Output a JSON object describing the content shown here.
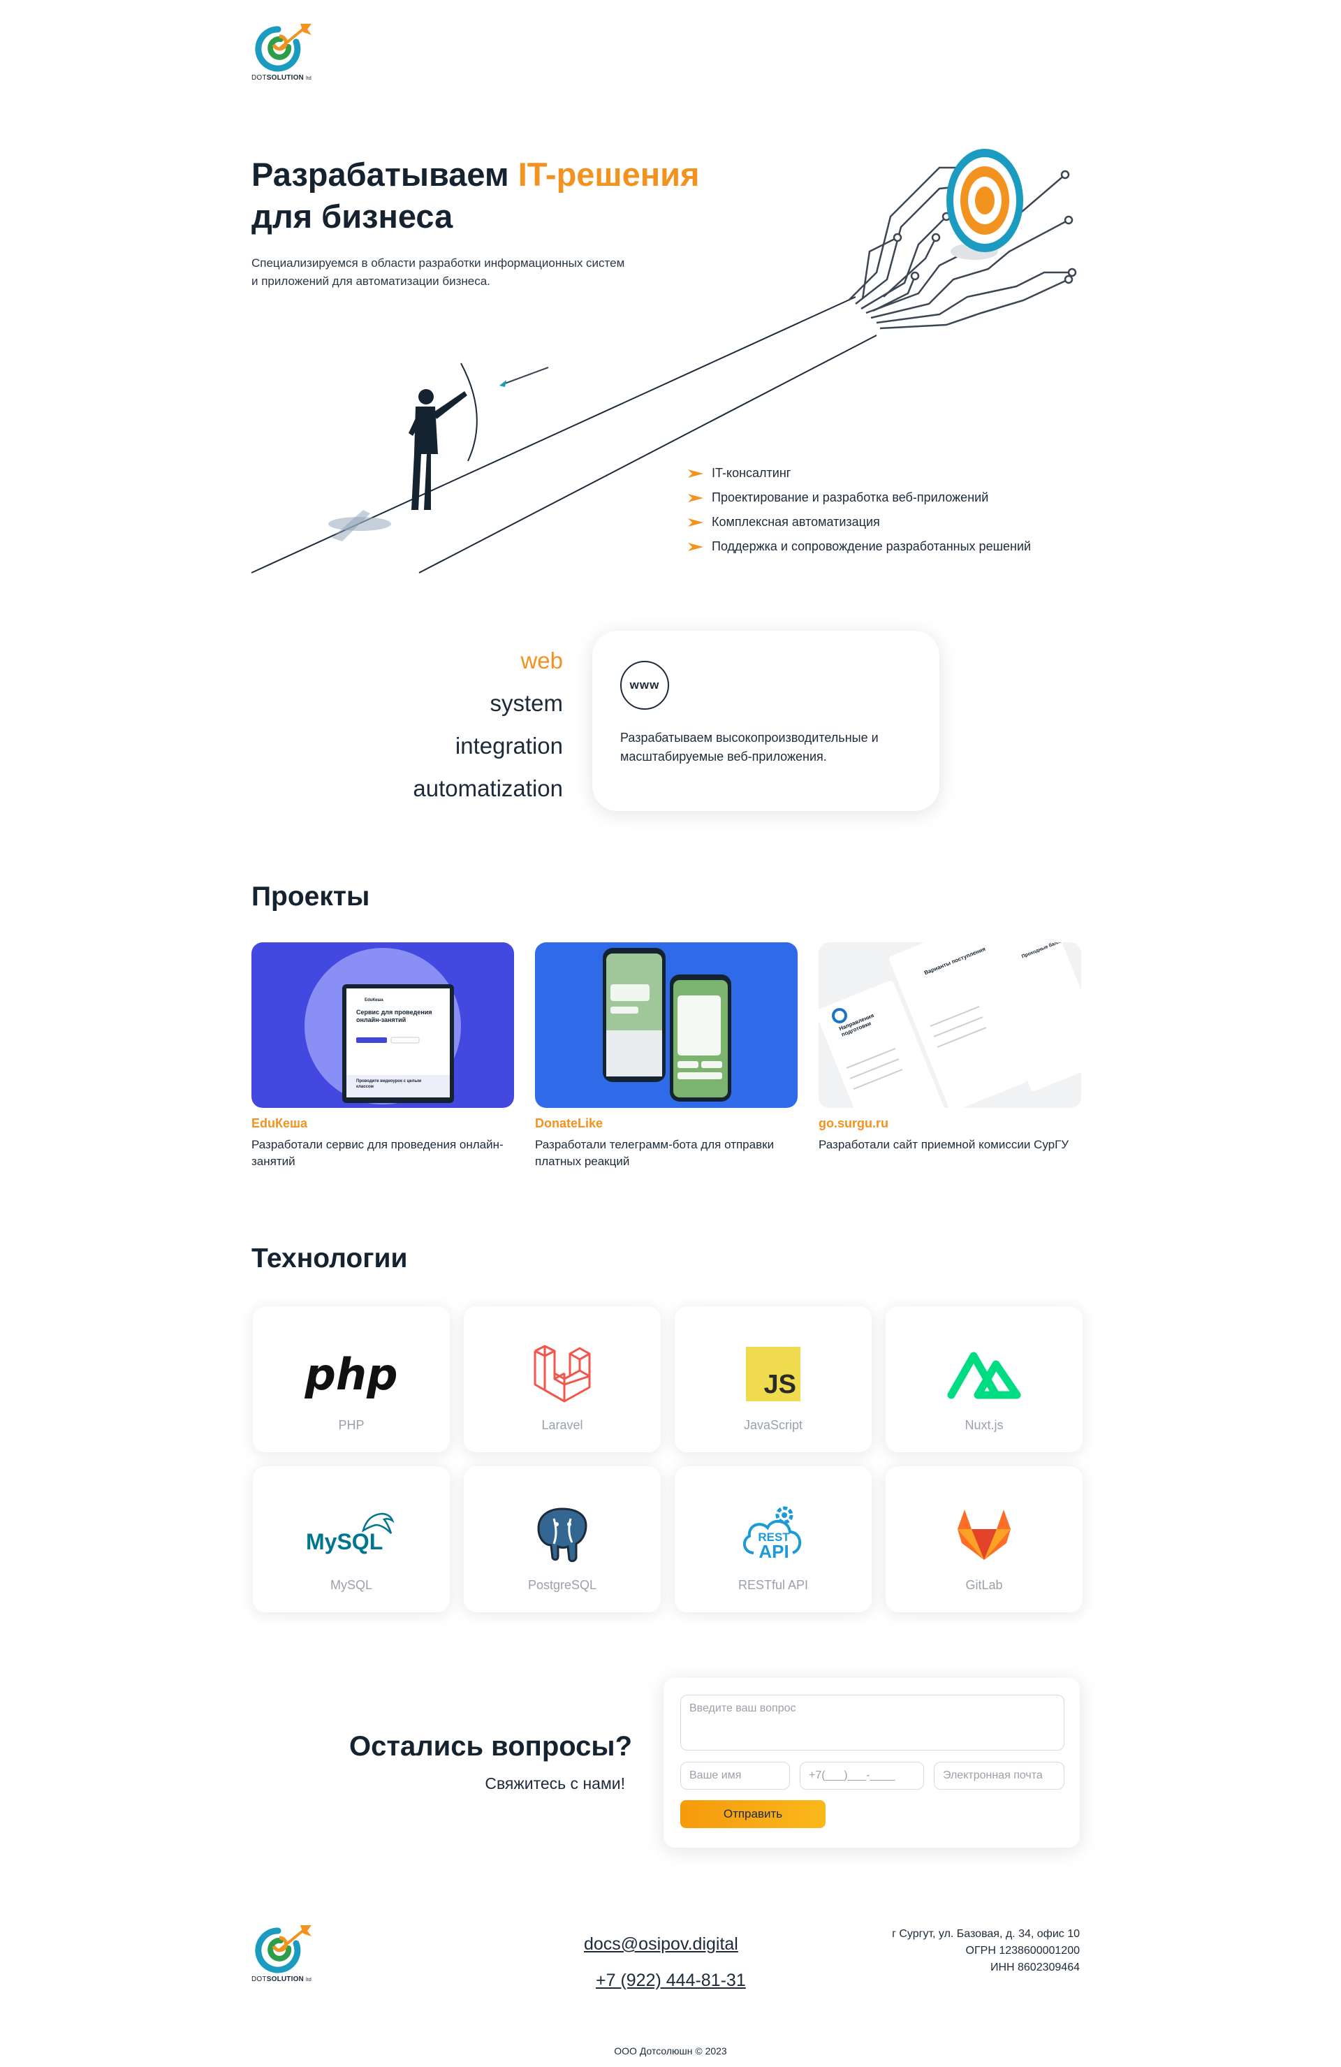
{
  "brand": {
    "name_light": "DOT",
    "name_bold": "SOLUTION",
    "suffix": "ltd"
  },
  "hero": {
    "title_part1": "Разрабатываем ",
    "title_highlight": "IT-решения",
    "title_part2": "для бизнеса",
    "subtitle": "Специализируемся в области разработки информационных систем и приложений для автоматизации бизнеса.",
    "services": [
      "IT-консалтинг",
      "Проектирование и разработка веб-приложений",
      "Комплексная автоматизация",
      "Поддержка и сопровождение разработанных решений"
    ]
  },
  "directions": {
    "items": [
      "web",
      "system",
      "integration",
      "automatization"
    ],
    "active": "web",
    "card_icon_text": "www",
    "card_text": "Разрабатываем высокопроизводительные и масштабируемые веб-приложения."
  },
  "projects": {
    "title": "Проекты",
    "items": [
      {
        "name": "EduКеша",
        "desc": "Разработали сервис для проведения онлайн-занятий",
        "color": "#4349e0"
      },
      {
        "name": "DonateLike",
        "desc": "Разработали телеграмм-бота для отправки платных реакций",
        "color": "#2f6be8"
      },
      {
        "name": "go.surgu.ru",
        "desc": "Разработали сайт приемной комиссии СурГУ",
        "color": "#f1f2f4"
      }
    ],
    "edu_mock": {
      "brand": "EduКеша",
      "heading": "Сервис для проведения онлайн-занятий",
      "promo": "Проводите видеоурок с целым классом"
    },
    "surgu_mock": {
      "panel1": "Направления подготовки",
      "panel2": "Варианты поступления",
      "panel3": "Проходные баллы"
    }
  },
  "technologies": {
    "title": "Технологии",
    "items": [
      {
        "label": "PHP",
        "icon": "php-icon"
      },
      {
        "label": "Laravel",
        "icon": "laravel-icon"
      },
      {
        "label": "JavaScript",
        "icon": "javascript-icon"
      },
      {
        "label": "Nuxt.js",
        "icon": "nuxt-icon"
      },
      {
        "label": "MySQL",
        "icon": "mysql-icon"
      },
      {
        "label": "PostgreSQL",
        "icon": "postgresql-icon"
      },
      {
        "label": "RESTful API",
        "icon": "rest-api-icon"
      },
      {
        "label": "GitLab",
        "icon": "gitlab-icon"
      }
    ],
    "php_text": "php",
    "js_text": "JS",
    "mysql_text": "MySQL",
    "rest_text": "REST",
    "api_text": "API"
  },
  "contact": {
    "title": "Остались вопросы?",
    "subtitle": "Свяжитесь с нами!",
    "question_placeholder": "Введите ваш вопрос",
    "name_placeholder": "Ваше имя",
    "phone_placeholder": "+7(___)___-____",
    "email_placeholder": "Электронная почта",
    "submit_label": "Отправить"
  },
  "footer": {
    "email": "docs@osipov.digital",
    "phone": "+7 (922) 444-81-31",
    "address": "г Сургут, ул. Базовая, д. 34, офис 10",
    "ogrn": "ОГРН 1238600001200",
    "inn": "ИНН 8602309464",
    "copyright": "ООО Дотсолюшн © 2023"
  },
  "colors": {
    "accent": "#f2921f",
    "dark": "#15222f",
    "teal": "#1a9bbf"
  }
}
